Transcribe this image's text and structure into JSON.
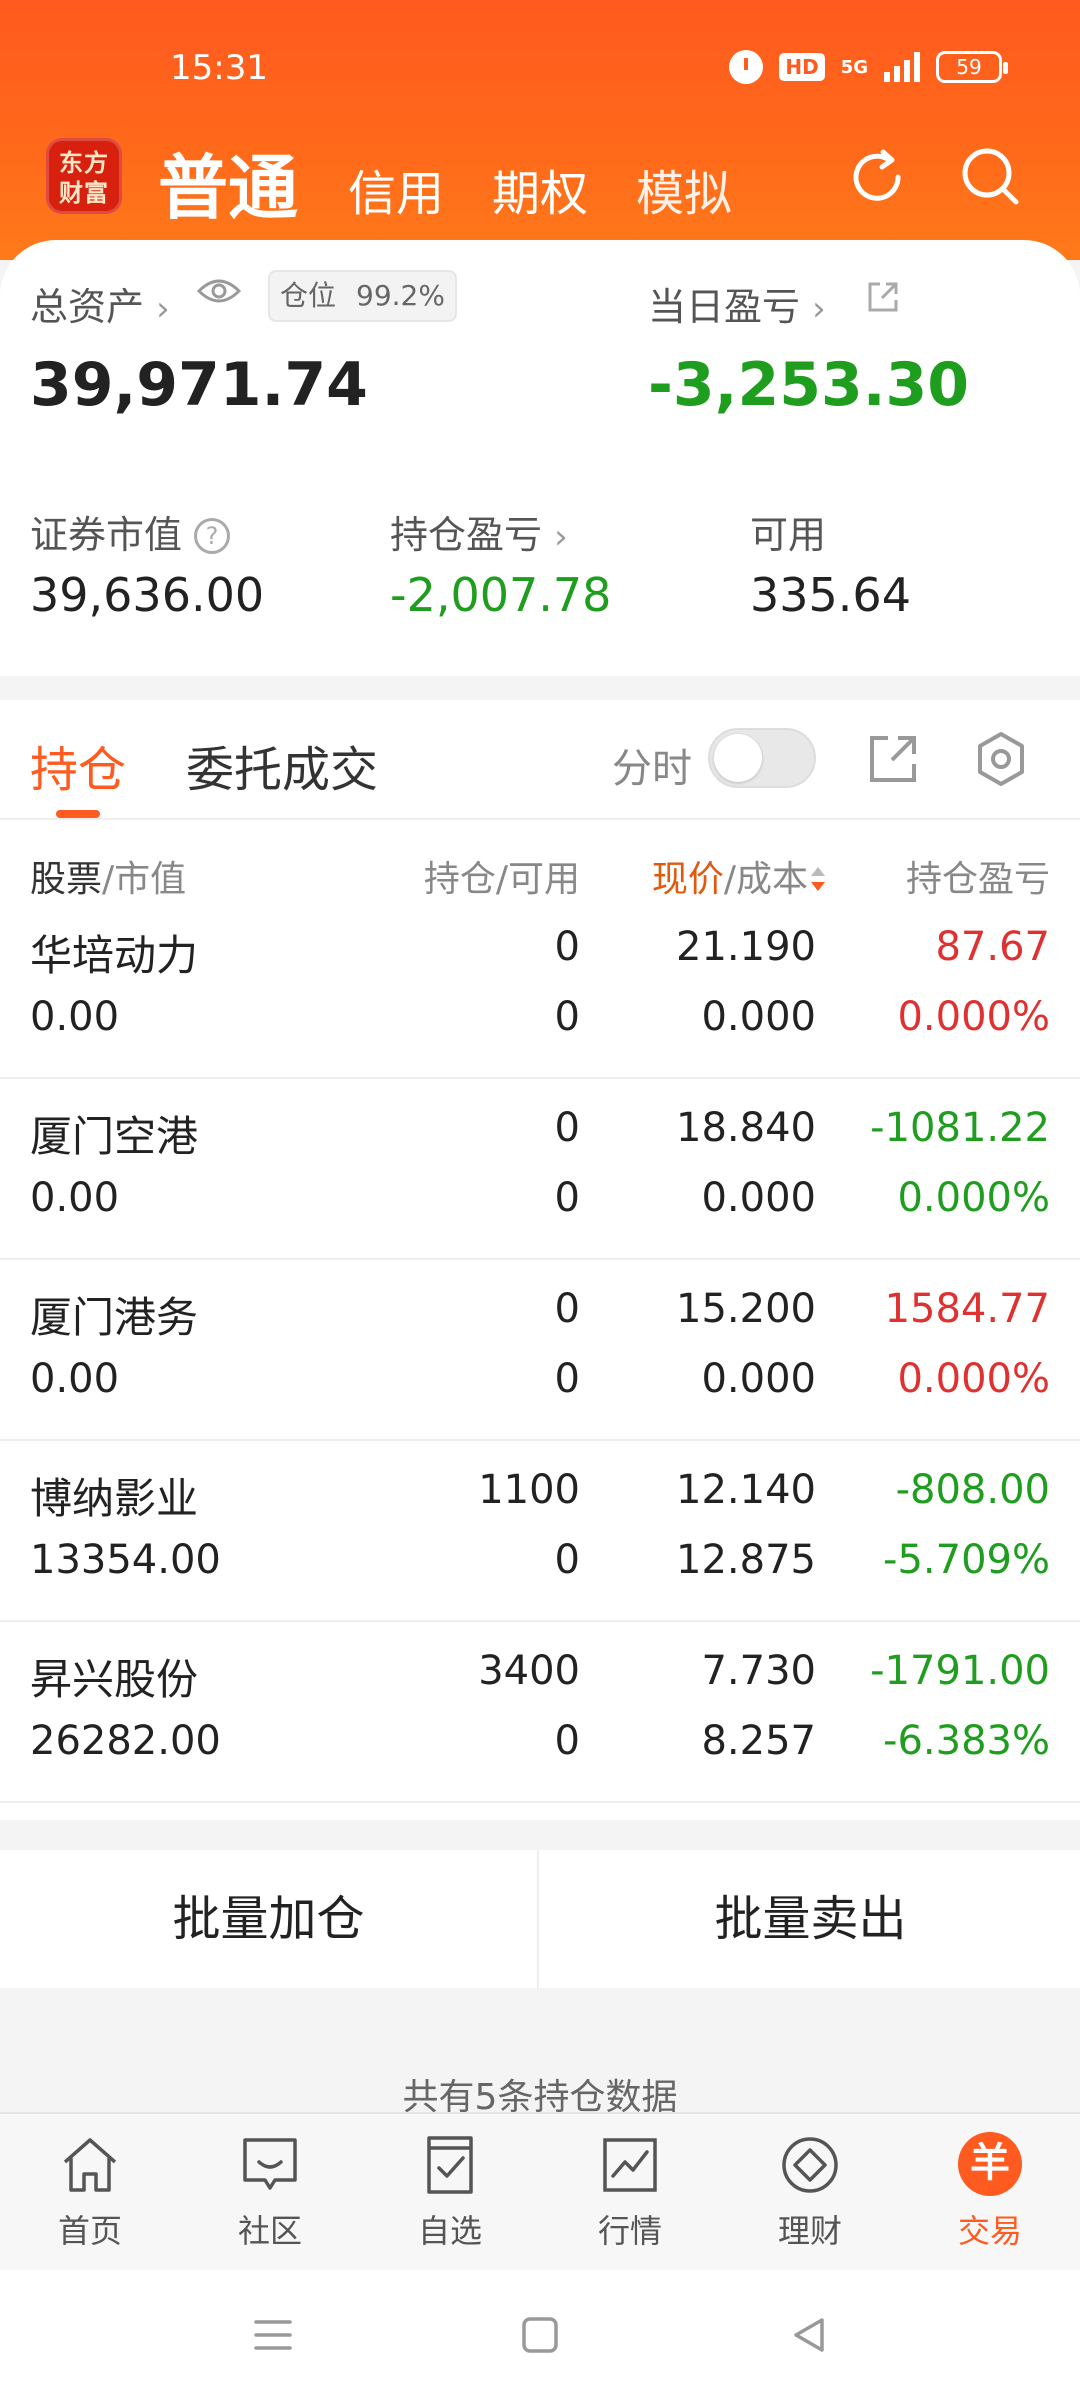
{
  "status": {
    "time": "15:31",
    "hd": "HD",
    "network": "5G",
    "battery": "59"
  },
  "header": {
    "logo_line1": "东方",
    "logo_line2": "财富",
    "tabs": [
      {
        "label": "普通"
      },
      {
        "label": "信用"
      },
      {
        "label": "期权"
      },
      {
        "label": "模拟"
      }
    ]
  },
  "summary": {
    "total_assets_label": "总资产",
    "position_label": "仓位",
    "position_value": "99.2%",
    "total_assets": "39,971.74",
    "day_pl_label": "当日盈亏",
    "day_pl": "-3,253.30",
    "market_value_label": "证券市值",
    "market_value": "39,636.00",
    "holding_pl_label": "持仓盈亏",
    "holding_pl": "-2,007.78",
    "available_label": "可用",
    "available": "335.64"
  },
  "holdings_tabs": {
    "positions": "持仓",
    "orders": "委托成交",
    "intraday": "分时"
  },
  "columns": {
    "stock": "股票",
    "mv": "/市值",
    "qty": "持仓/可用",
    "price": "现价",
    "cost": "/成本",
    "pl": "持仓盈亏"
  },
  "rows": [
    {
      "name": "华培动力",
      "mv": "0.00",
      "qty": "0",
      "avail": "0",
      "price": "21.190",
      "cost": "0.000",
      "pl": "87.67",
      "pl_pct": "0.000%",
      "pl_color": "red",
      "pct_color": "red"
    },
    {
      "name": "厦门空港",
      "mv": "0.00",
      "qty": "0",
      "avail": "0",
      "price": "18.840",
      "cost": "0.000",
      "pl": "-1081.22",
      "pl_pct": "0.000%",
      "pl_color": "green",
      "pct_color": "green"
    },
    {
      "name": "厦门港务",
      "mv": "0.00",
      "qty": "0",
      "avail": "0",
      "price": "15.200",
      "cost": "0.000",
      "pl": "1584.77",
      "pl_pct": "0.000%",
      "pl_color": "red",
      "pct_color": "red"
    },
    {
      "name": "博纳影业",
      "mv": "13354.00",
      "qty": "1100",
      "avail": "0",
      "price": "12.140",
      "cost": "12.875",
      "pl": "-808.00",
      "pl_pct": "-5.709%",
      "pl_color": "green",
      "pct_color": "green"
    },
    {
      "name": "昇兴股份",
      "mv": "26282.00",
      "qty": "3400",
      "avail": "0",
      "price": "7.730",
      "cost": "8.257",
      "pl": "-1791.00",
      "pl_pct": "-6.383%",
      "pl_color": "green",
      "pct_color": "green"
    }
  ],
  "batch": {
    "add": "批量加仓",
    "sell": "批量卖出"
  },
  "count_text": "共有5条持仓数据",
  "tabbar": [
    {
      "label": "首页",
      "icon": "home-icon"
    },
    {
      "label": "社区",
      "icon": "community-icon"
    },
    {
      "label": "自选",
      "icon": "watchlist-icon"
    },
    {
      "label": "行情",
      "icon": "market-icon"
    },
    {
      "label": "理财",
      "icon": "wealth-icon"
    },
    {
      "label": "交易",
      "icon": "trade-icon",
      "glyph": "羊"
    }
  ],
  "colors": {
    "accent": "#ff5a1f",
    "gain": "#e03131",
    "loss": "#1f9d1f"
  }
}
